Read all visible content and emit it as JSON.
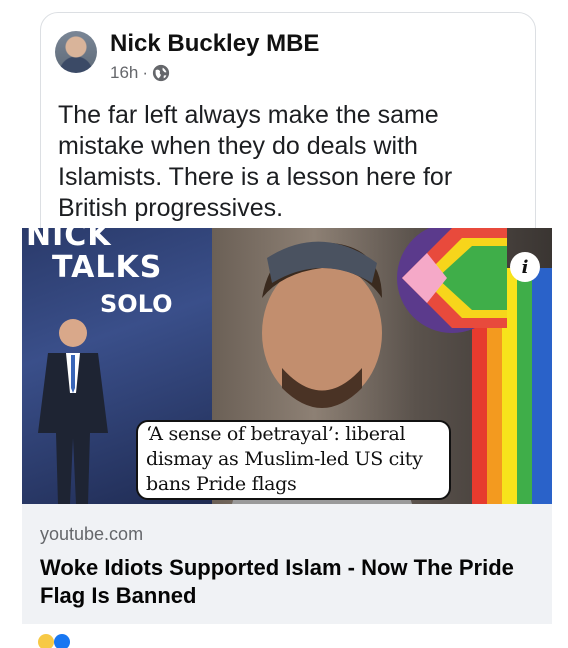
{
  "post": {
    "author": "Nick Buckley MBE",
    "time": "16h",
    "separator": "·",
    "privacy_icon": "globe-icon",
    "text": "The far left always make the same mistake when they do deals with Islamists. There is a lesson here for British progressives."
  },
  "preview": {
    "show_name_line1": "NICK",
    "show_name_line2": "TALKS",
    "show_name_line3": "SOLO",
    "info_label": "i",
    "headline": "‘A sense of betrayal’: liberal\ndismay as Muslim-led US city\nbans Pride flags"
  },
  "link": {
    "domain": "youtube.com",
    "title": "Woke Idiots Supported Islam - Now The Pride Flag Is Banned"
  },
  "colors": {
    "footer_bg": "#f0f2f5",
    "author": "#111111",
    "meta": "#65676b"
  }
}
